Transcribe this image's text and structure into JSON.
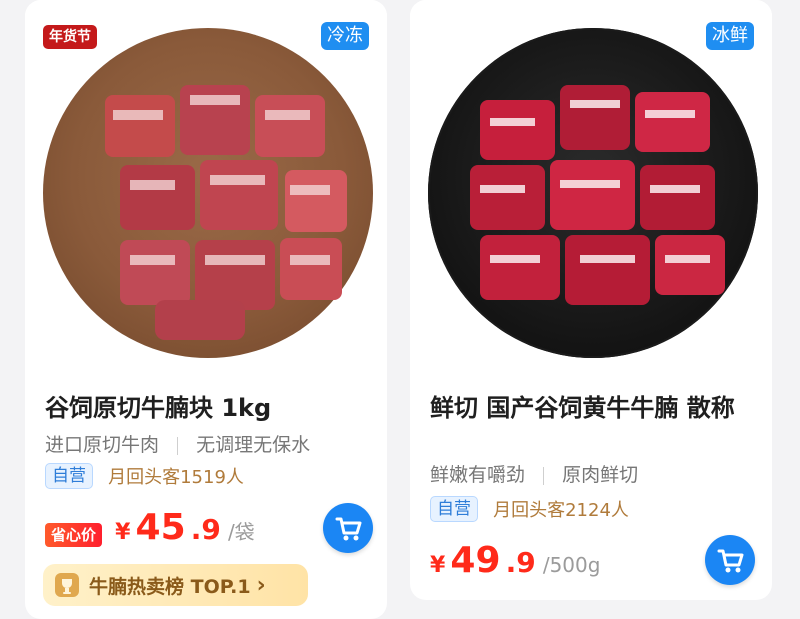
{
  "cards": [
    {
      "corner_tag": "年货节",
      "storage_tag": "冷冻",
      "title": "谷饲原切牛腩块 1kg",
      "subtitle_left": "进口原切牛肉",
      "subtitle_right": "无调理无保水",
      "self_badge": "自营",
      "returning": "月回头客1519人",
      "promo_label": "省心价",
      "price_symbol": "¥",
      "price_int": "45",
      "price_decimal": ".9",
      "price_unit": "/袋",
      "rank_text": "牛腩热卖榜 TOP.1",
      "rank_arrow": "›"
    },
    {
      "storage_tag": "冰鲜",
      "title": "鲜切 国产谷饲黄牛牛腩 散称",
      "subtitle_left": "鲜嫩有嚼劲",
      "subtitle_right": "原肉鲜切",
      "self_badge": "自营",
      "returning": "月回头客2124人",
      "price_symbol": "¥",
      "price_int": "49",
      "price_decimal": ".9",
      "price_unit": "/500g"
    }
  ],
  "colors": {
    "price_red": "#ff2a1a",
    "cart_blue": "#1b86f4",
    "tag_red": "#c4191a",
    "tag_blue": "#1f8ef1"
  },
  "icons": {
    "cart": "cart-icon",
    "trophy": "trophy-icon"
  }
}
